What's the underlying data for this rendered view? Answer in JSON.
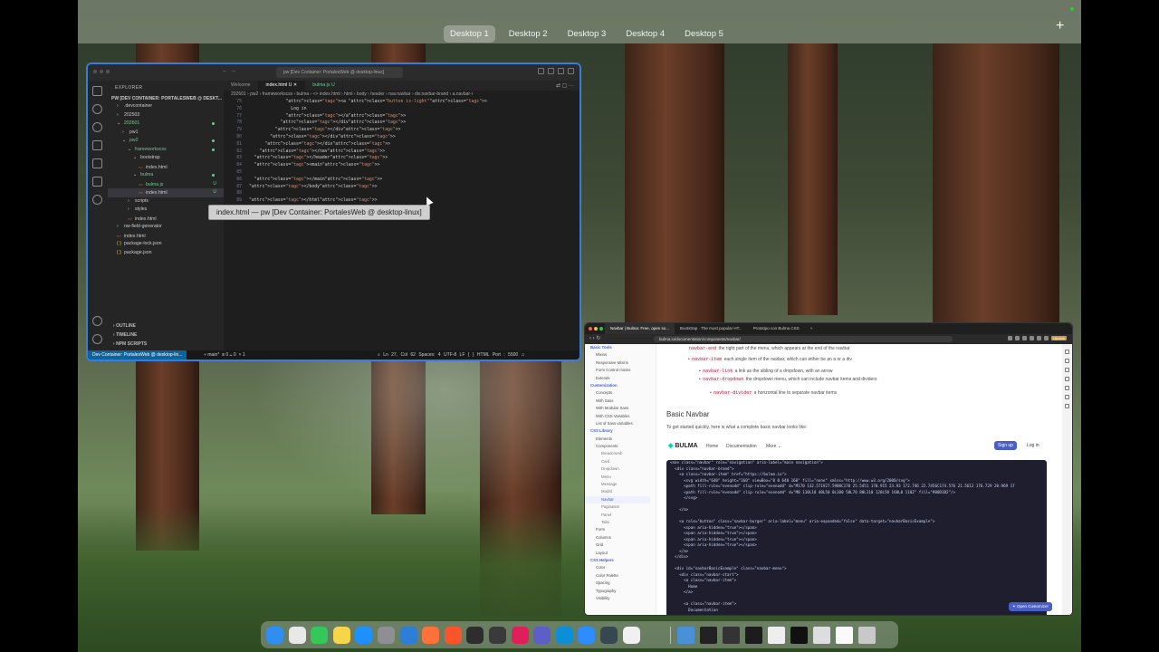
{
  "mission_control": {
    "desktops": [
      "Desktop 1",
      "Desktop 2",
      "Desktop 3",
      "Desktop 4",
      "Desktop 5"
    ],
    "active_desktop": "Desktop 1",
    "add_label": "+"
  },
  "vscode": {
    "title": "pw [Dev Container: PortalesWeb @ desktop-linux]",
    "explorer_header": "EXPLORER",
    "root": "PW [DEV CONTAINER: PORTALESWEB @ DESKT...",
    "tree": [
      {
        "label": ".devcontainer",
        "indent": 1,
        "chev": "›"
      },
      {
        "label": "202503",
        "indent": 1,
        "chev": "›"
      },
      {
        "label": "202601",
        "indent": 1,
        "chev": "⌄",
        "mod": true
      },
      {
        "label": "pw1",
        "indent": 2,
        "chev": "›"
      },
      {
        "label": "pw2",
        "indent": 2,
        "chev": "⌄",
        "mod": true
      },
      {
        "label": "frameworkscss",
        "indent": 3,
        "chev": "⌄",
        "mod": true
      },
      {
        "label": "bootstrap",
        "indent": 4,
        "chev": "⌄"
      },
      {
        "label": "index.html",
        "indent": 5,
        "chev": ""
      },
      {
        "label": "bulma",
        "indent": 4,
        "chev": "⌄",
        "mod": true
      },
      {
        "label": "bulma.js",
        "indent": 5,
        "chev": "",
        "mod": true,
        "badge": "U"
      },
      {
        "label": "index.html",
        "indent": 5,
        "chev": "",
        "selected": true,
        "badge": "U"
      },
      {
        "label": "scripts",
        "indent": 3,
        "chev": "›"
      },
      {
        "label": "styles",
        "indent": 3,
        "chev": "›"
      },
      {
        "label": "index.html",
        "indent": 3,
        "chev": ""
      },
      {
        "label": "nw-field-generator",
        "indent": 1,
        "chev": "›"
      },
      {
        "label": "index.html",
        "indent": 1,
        "chev": ""
      },
      {
        "label": "package-lock.json",
        "indent": 1,
        "chev": "{ }"
      },
      {
        "label": "package.json",
        "indent": 1,
        "chev": "{ }"
      }
    ],
    "sections": [
      "OUTLINE",
      "TIMELINE",
      "NPM SCRIPTS"
    ],
    "tabs": [
      {
        "label": "Welcome",
        "state": ""
      },
      {
        "label": "index.html U",
        "state": "active"
      },
      {
        "label": "bulma.js U",
        "state": "untracked"
      }
    ],
    "breadcrumb": "202601 › pw2 › frameworkscss › bulma › <> index.html › html › body › header › nav.navbar › div.navbar-brand › a.navbar-i",
    "code_lines": [
      {
        "n": "75",
        "indent": "              ",
        "html": "<a class=\"button is-light\">"
      },
      {
        "n": "76",
        "indent": "                ",
        "html": "Log in"
      },
      {
        "n": "77",
        "indent": "              ",
        "html": "</a>"
      },
      {
        "n": "78",
        "indent": "            ",
        "html": "</div>"
      },
      {
        "n": "79",
        "indent": "          ",
        "html": "</div>"
      },
      {
        "n": "80",
        "indent": "        ",
        "html": "</div>"
      },
      {
        "n": "81",
        "indent": "      ",
        "html": "</div>"
      },
      {
        "n": "82",
        "indent": "    ",
        "html": "</nav>"
      },
      {
        "n": "83",
        "indent": "  ",
        "html": "</header>"
      },
      {
        "n": "84",
        "indent": "  ",
        "html": "<main>"
      },
      {
        "n": "85",
        "indent": "",
        "html": ""
      },
      {
        "n": "86",
        "indent": "  ",
        "html": "</main>"
      },
      {
        "n": "87",
        "indent": "",
        "html": "</body>"
      },
      {
        "n": "88",
        "indent": "",
        "html": ""
      },
      {
        "n": "89",
        "indent": "",
        "html": "</html>"
      }
    ],
    "tooltip": "index.html — pw [Dev Container: PortalesWeb @ desktop-linux]",
    "status": {
      "remote": "Dev Container: PortalesWeb @ desktop-lin...",
      "branch": "main*",
      "problems": "⊗ 0  ⚠ 0",
      "ports": "1",
      "position": "Ln 27, Col 62",
      "spaces": "Spaces: 4",
      "encoding": "UTF-8",
      "eol": "LF",
      "language": "{ } HTML",
      "port": "Port : 5500"
    }
  },
  "browser": {
    "tabs": [
      "Navbar | Bulma: Free, open so...",
      "Bootstrap · The most popular HT...",
      "Prototipo con Bulma CSS"
    ],
    "url": "bulma.io/documentation/components/navbar/",
    "update_label": "Update",
    "sidebar": [
      {
        "label": "Basic Tools",
        "type": "section"
      },
      {
        "label": "Mixins",
        "type": ""
      },
      {
        "label": "Responsive Mixins",
        "type": ""
      },
      {
        "label": "Form Control mixins",
        "type": ""
      },
      {
        "label": "Extends",
        "type": ""
      },
      {
        "label": "Customization",
        "type": "section"
      },
      {
        "label": "Concepts",
        "type": ""
      },
      {
        "label": "With Sass",
        "type": ""
      },
      {
        "label": "With Modular Sass",
        "type": ""
      },
      {
        "label": "With CSS Variables",
        "type": ""
      },
      {
        "label": "List of Sass variables",
        "type": ""
      },
      {
        "label": "CSS Library",
        "type": "section"
      },
      {
        "label": "Elements",
        "type": ""
      },
      {
        "label": "Components",
        "type": ""
      },
      {
        "label": "Breadcrumb",
        "type": "sub"
      },
      {
        "label": "Card",
        "type": "sub"
      },
      {
        "label": "Dropdown",
        "type": "sub"
      },
      {
        "label": "Menu",
        "type": "sub"
      },
      {
        "label": "Message",
        "type": "sub"
      },
      {
        "label": "Modal",
        "type": "sub"
      },
      {
        "label": "Navbar",
        "type": "sub current"
      },
      {
        "label": "Pagination",
        "type": "sub"
      },
      {
        "label": "Panel",
        "type": "sub"
      },
      {
        "label": "Tabs",
        "type": "sub"
      },
      {
        "label": "Form",
        "type": ""
      },
      {
        "label": "Columns",
        "type": ""
      },
      {
        "label": "Grid",
        "type": ""
      },
      {
        "label": "Layout",
        "type": ""
      },
      {
        "label": "CSS Helpers",
        "type": "section"
      },
      {
        "label": "Color",
        "type": ""
      },
      {
        "label": "Color Palette",
        "type": ""
      },
      {
        "label": "Spacing",
        "type": ""
      },
      {
        "label": "Typography",
        "type": ""
      },
      {
        "label": "Visibility",
        "type": ""
      }
    ],
    "doc": {
      "line1_code": "navbar-end",
      "line1_text": " the right part of the menu, which appears at the end of the navbar",
      "line2_code": "navbar-item",
      "line2_text": " each single item of the navbar, which can either be an  a  or a  div",
      "line3_code": "navbar-link",
      "line3_text": " a link as the sibling of a dropdown, with an arrow",
      "line4_code": "navbar-dropdown",
      "line4_text": " the dropdown menu, which can include navbar items and dividers",
      "line5_code": "navbar-divider",
      "line5_text": " a horizontal line to separate navbar items",
      "heading": "Basic Navbar",
      "intro": "To get started quickly, here is what a complete basic navbar looks like:",
      "logo": "BULMA",
      "nav_items": [
        "Home",
        "Documentation",
        "More ⌄"
      ],
      "signup": "Sign up",
      "login": "Log in",
      "customize": "Open Customizer"
    },
    "code_lines": [
      "<nav class=\"navbar\" role=\"navigation\" aria-label=\"main navigation\">",
      "  <div class=\"navbar-brand\">",
      "    <a class=\"navbar-item\" href=\"https://bulma.io\">",
      "      <svg width=\"640\" height=\"160\" viewBox=\"0 0 640 160\" fill=\"none\" xmlns=\"http://www.w3.org/2000/svg\">",
      "      <path fill-rule=\"evenodd\" clip-rule=\"evenodd\" d=\"M170 132.571V27.5908C170 25.5451 170.915 23.93 172.746 22.7456C174.576 21.5612 176.729 20.969 17",
      "      <path fill-rule=\"evenodd\" clip-rule=\"evenodd\" d=\"M0 110L10 40L50 0L100 50L70 80L110 120L50 160L0 110Z\" fill=\"#00D1B2\"/>",
      "      </svg>",
      "",
      "    </a>",
      "",
      "    <a role=\"button\" class=\"navbar-burger\" aria-label=\"menu\" aria-expanded=\"false\" data-target=\"navbarBasicExample\">",
      "      <span aria-hidden=\"true\"></span>",
      "      <span aria-hidden=\"true\"></span>",
      "      <span aria-hidden=\"true\"></span>",
      "      <span aria-hidden=\"true\"></span>",
      "    </a>",
      "  </div>",
      "",
      "  <div id=\"navbarBasicExample\" class=\"navbar-menu\">",
      "    <div class=\"navbar-start\">",
      "      <a class=\"navbar-item\">",
      "        Home",
      "      </a>",
      "",
      "      <a class=\"navbar-item\">",
      "        Documentation"
    ]
  },
  "dock": {
    "apps": [
      {
        "name": "finder-icon",
        "color": "#2f8ef0"
      },
      {
        "name": "launchpad-icon",
        "color": "#e8e8e8"
      },
      {
        "name": "facetime-icon",
        "color": "#34c759"
      },
      {
        "name": "notes-icon",
        "color": "#f7d54a"
      },
      {
        "name": "app-store-icon",
        "color": "#1e90ff"
      },
      {
        "name": "settings-icon",
        "color": "#8e8e93"
      },
      {
        "name": "vscode-icon",
        "color": "#2c7ed6"
      },
      {
        "name": "firefox-icon",
        "color": "#ff7139"
      },
      {
        "name": "brave-icon",
        "color": "#fb542b"
      },
      {
        "name": "terminal-icon",
        "color": "#2d2d2d"
      },
      {
        "name": "console-icon",
        "color": "#3a3a3a"
      },
      {
        "name": "slack-icon",
        "color": "#e01e5a"
      },
      {
        "name": "teams-icon",
        "color": "#5b5fc7"
      },
      {
        "name": "edge-icon",
        "color": "#0c8fd6"
      },
      {
        "name": "zoom-icon",
        "color": "#2d8cff"
      },
      {
        "name": "vpn-icon",
        "color": "#37474f"
      },
      {
        "name": "chatgpt-icon",
        "color": "#f0f0f0"
      }
    ],
    "minimized": [
      {
        "name": "downloads-folder-icon",
        "color": "#4a90d9"
      },
      {
        "name": "minimized-window-1-icon",
        "color": "#222"
      },
      {
        "name": "minimized-window-2-icon",
        "color": "#333"
      },
      {
        "name": "minimized-window-3-icon",
        "color": "#1c1c1c"
      },
      {
        "name": "minimized-window-4-icon",
        "color": "#eee"
      },
      {
        "name": "minimized-window-5-icon",
        "color": "#111"
      },
      {
        "name": "minimized-window-6-icon",
        "color": "#ddd"
      },
      {
        "name": "minimized-window-7-icon",
        "color": "#fafafa"
      },
      {
        "name": "trash-icon",
        "color": "#c8c8c8"
      }
    ]
  }
}
